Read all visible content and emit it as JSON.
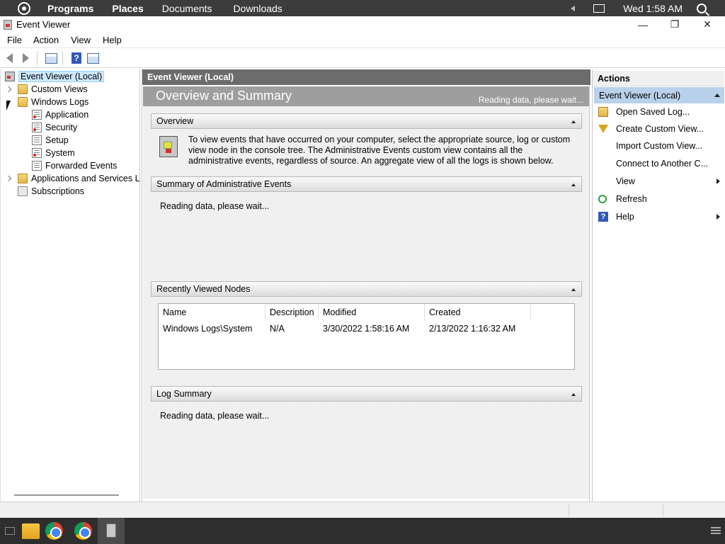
{
  "topbar": {
    "menus": [
      "Programs",
      "Places",
      "Documents",
      "Downloads"
    ],
    "clock": "Wed 1:58 AM"
  },
  "window": {
    "title": "Event Viewer",
    "minimize": "—",
    "restore": "❐",
    "close": "✕"
  },
  "menubar": {
    "file": "File",
    "action": "Action",
    "view": "View",
    "help": "Help"
  },
  "toolbar": {
    "help_glyph": "?"
  },
  "tree": {
    "root": "Event Viewer (Local)",
    "custom_views": "Custom Views",
    "windows_logs": "Windows Logs",
    "application": "Application",
    "security": "Security",
    "setup": "Setup",
    "system": "System",
    "forwarded_events": "Forwarded Events",
    "apps_services": "Applications and Services Lo",
    "subscriptions": "Subscriptions"
  },
  "center": {
    "header": "Event Viewer (Local)",
    "heading": "Overview and Summary",
    "status": "Reading data, please wait...",
    "overview": {
      "title": "Overview",
      "text": "To view events that have occurred on your computer, select the appropriate source, log or custom view node in the console tree. The Administrative Events custom view contains all the administrative events, regardless of source. An aggregate view of all the logs is shown below."
    },
    "admin_summary": {
      "title": "Summary of Administrative Events",
      "text": "Reading data, please wait..."
    },
    "recent_nodes": {
      "title": "Recently Viewed Nodes",
      "columns": [
        "Name",
        "Description",
        "Modified",
        "Created"
      ],
      "rows": [
        {
          "name": "Windows Logs\\System",
          "description": "N/A",
          "modified": "3/30/2022 1:58:16 AM",
          "created": "2/13/2022 1:16:32 AM"
        }
      ]
    },
    "log_summary": {
      "title": "Log Summary",
      "text": "Reading data, please wait..."
    }
  },
  "actions": {
    "title": "Actions",
    "group": "Event Viewer (Local)",
    "items": [
      "Open Saved Log...",
      "Create Custom View...",
      "Import Custom View...",
      "Connect to Another C...",
      "View",
      "Refresh",
      "Help"
    ]
  }
}
